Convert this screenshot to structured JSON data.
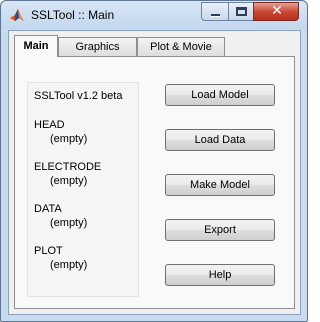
{
  "window": {
    "title": "SSLTool :: Main"
  },
  "controls": {
    "close_glyph": "✕"
  },
  "tabs": [
    {
      "label": "Main"
    },
    {
      "label": "Graphics"
    },
    {
      "label": "Plot & Movie"
    }
  ],
  "status": {
    "version": "SSLTool v1.2 beta",
    "head_label": "HEAD",
    "head_value": "(empty)",
    "electrode_label": "ELECTRODE",
    "electrode_value": "(empty)",
    "data_label": "DATA",
    "data_value": "(empty)",
    "plot_label": "PLOT",
    "plot_value": "(empty)"
  },
  "buttons": {
    "load_model": "Load Model",
    "load_data": "Load Data",
    "make_model": "Make Model",
    "export": "Export",
    "help": "Help"
  },
  "icons": {
    "app": "matlab-icon",
    "minimize": "minimize-icon",
    "maximize": "maximize-icon",
    "close": "close-icon"
  }
}
